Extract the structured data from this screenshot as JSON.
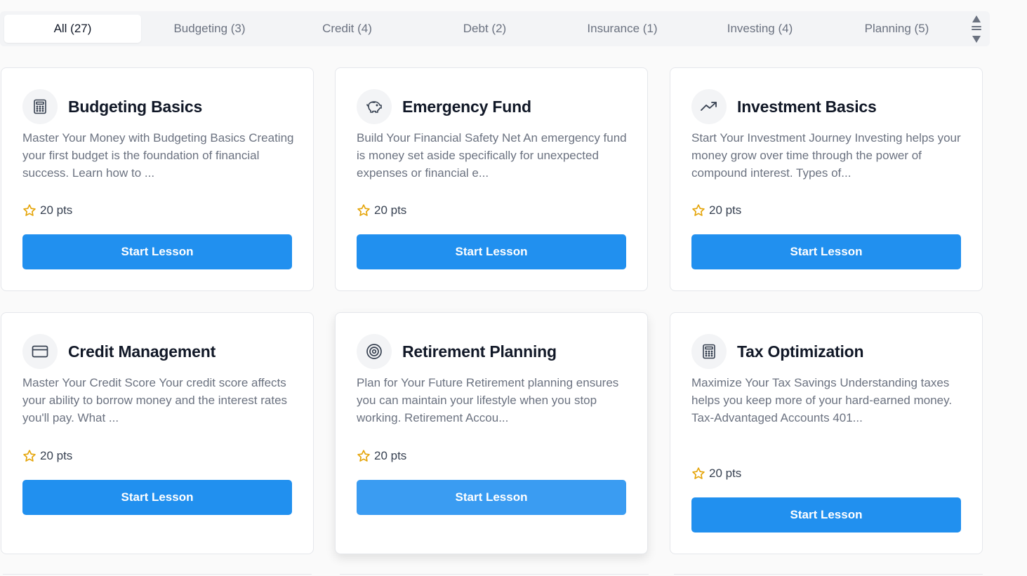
{
  "tabs": [
    {
      "label": "All (27)",
      "active": true
    },
    {
      "label": "Budgeting (3)",
      "active": false
    },
    {
      "label": "Credit (4)",
      "active": false
    },
    {
      "label": "Debt (2)",
      "active": false
    },
    {
      "label": "Insurance (1)",
      "active": false
    },
    {
      "label": "Investing (4)",
      "active": false
    },
    {
      "label": "Planning (5)",
      "active": false
    }
  ],
  "lessons": [
    {
      "title": "Budgeting Basics",
      "icon": "calculator-icon",
      "description": "Master Your Money with Budgeting Basics Creating your first budget is the foundation of financial success. Learn how to ...",
      "points": "20 pts",
      "button": "Start Lesson"
    },
    {
      "title": "Emergency Fund",
      "icon": "piggy-bank-icon",
      "description": "Build Your Financial Safety Net An emergency fund is money set aside specifically for unexpected expenses or financial e...",
      "points": "20 pts",
      "button": "Start Lesson"
    },
    {
      "title": "Investment Basics",
      "icon": "trending-up-icon",
      "description": "Start Your Investment Journey Investing helps your money grow over time through the power of compound interest. Types of...",
      "points": "20 pts",
      "button": "Start Lesson"
    },
    {
      "title": "Credit Management",
      "icon": "credit-card-icon",
      "description": "Master Your Credit Score Your credit score affects your ability to borrow money and the interest rates you'll pay. What ...",
      "points": "20 pts",
      "button": "Start Lesson"
    },
    {
      "title": "Retirement Planning",
      "icon": "target-icon",
      "description": "Plan for Your Future Retirement planning ensures you can maintain your lifestyle when you stop working. Retirement Accou...",
      "points": "20 pts",
      "button": "Start Lesson"
    },
    {
      "title": "Tax Optimization",
      "icon": "calculator-icon",
      "description": "Maximize Your Tax Savings Understanding taxes helps you keep more of your hard-earned money. Tax-Advantaged Accounts 401...",
      "points": "20 pts",
      "button": "Start Lesson"
    }
  ],
  "colors": {
    "primary_button": "#2190ef",
    "star": "#e5a50a",
    "muted_text": "#6b7280"
  }
}
